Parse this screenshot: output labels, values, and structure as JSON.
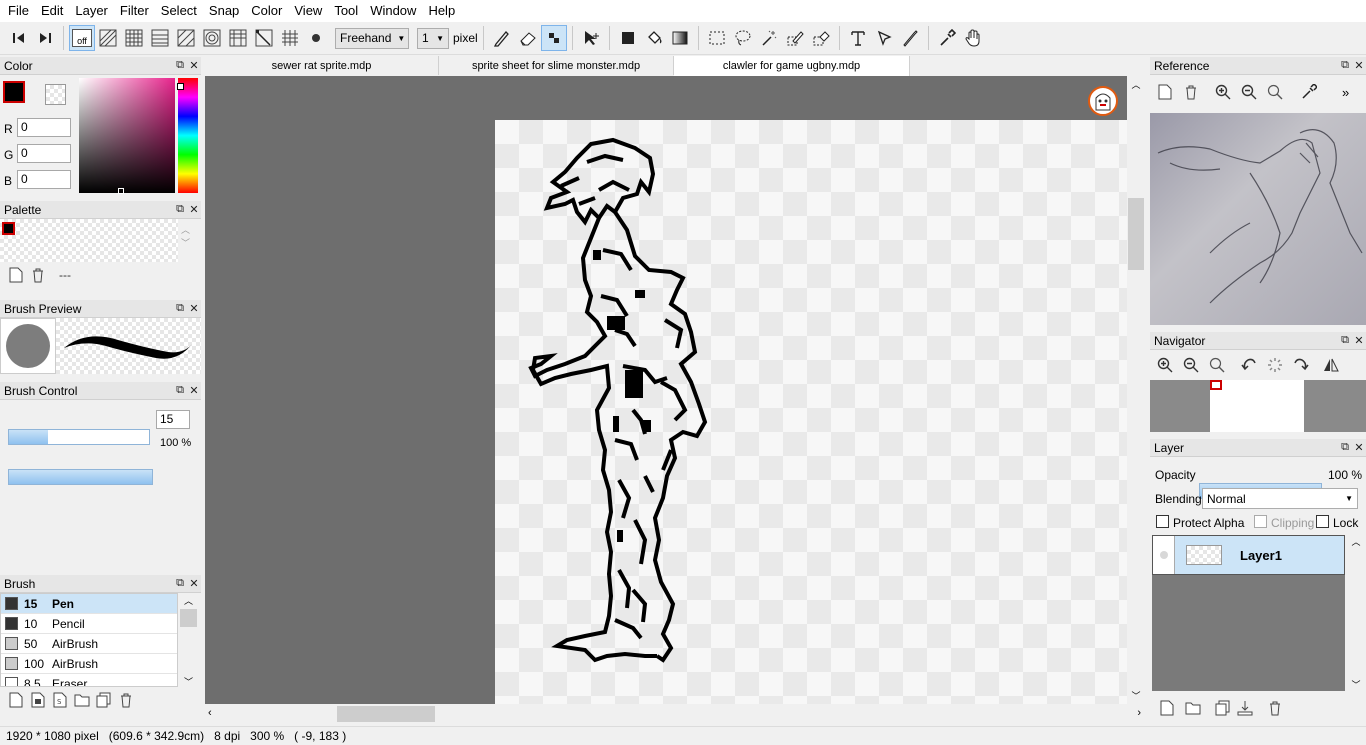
{
  "menu": [
    "File",
    "Edit",
    "Layer",
    "Filter",
    "Select",
    "Snap",
    "Color",
    "View",
    "Tool",
    "Window",
    "Help"
  ],
  "toolbar": {
    "snap_off_label": "off",
    "mode_select": "Freehand",
    "width_select": "1",
    "width_unit": "pixel"
  },
  "tabs": [
    "sewer rat sprite.mdp",
    "sprite sheet for slime monster.mdp",
    "clawler for game ugbny.mdp"
  ],
  "color_panel": {
    "title": "Color",
    "r_label": "R",
    "g_label": "G",
    "b_label": "B",
    "r": "0",
    "g": "0",
    "b": "0",
    "fg_color": "#000000",
    "bg_color": "#ffffff"
  },
  "palette_panel": {
    "title": "Palette",
    "placeholder": "---",
    "swatch_color": "#000000"
  },
  "brush_preview_panel": {
    "title": "Brush Preview"
  },
  "brush_control_panel": {
    "title": "Brush Control",
    "size": "15",
    "size_fraction": 0.28,
    "opacity": "100 %",
    "opacity_fraction": 1.0
  },
  "brush_panel": {
    "title": "Brush",
    "items": [
      {
        "size": "15",
        "name": "Pen",
        "swatch": "#333333",
        "selected": true
      },
      {
        "size": "10",
        "name": "Pencil",
        "swatch": "#333333",
        "selected": false
      },
      {
        "size": "50",
        "name": "AirBrush",
        "swatch": "#cccccc",
        "selected": false
      },
      {
        "size": "100",
        "name": "AirBrush",
        "swatch": "#cccccc",
        "selected": false
      },
      {
        "size": "8.5",
        "name": "Eraser",
        "swatch": "#ffffff",
        "selected": false
      }
    ]
  },
  "reference_panel": {
    "title": "Reference"
  },
  "navigator_panel": {
    "title": "Navigator"
  },
  "layer_panel": {
    "title": "Layer",
    "opacity_label": "Opacity",
    "opacity_value": "100 %",
    "opacity_fraction": 1.0,
    "blending_label": "Blending",
    "blending_value": "Normal",
    "protect_alpha": "Protect Alpha",
    "clipping": "Clipping",
    "lock": "Lock",
    "layers": [
      {
        "name": "Layer1"
      }
    ]
  },
  "status_bar": "1920 * 1080 pixel   (609.6 * 342.9cm)   8 dpi   300 %   ( -9, 183 )",
  "colors": {
    "accent": "#cce4f7",
    "canvas_bg": "#6e6e6e",
    "selection_red": "#cc0000"
  }
}
